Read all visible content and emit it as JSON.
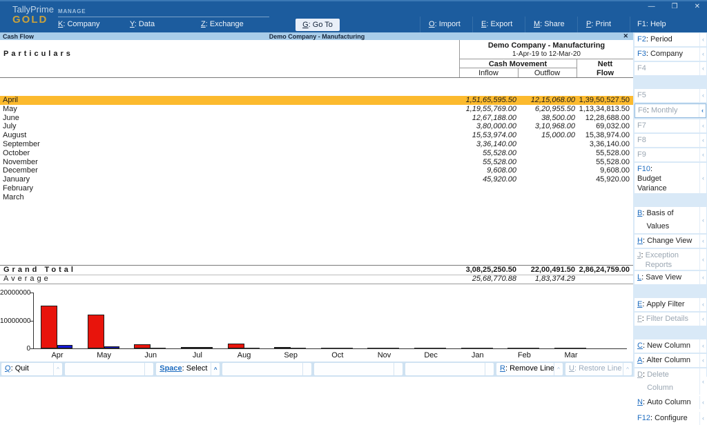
{
  "window": {
    "controls": {
      "minimize": "—",
      "maximize": "❐",
      "close": "✕"
    }
  },
  "brand": {
    "line1": "TallyPrime",
    "line2": "GOLD"
  },
  "topbar": {
    "manage": "MANAGE",
    "sep": ": ",
    "left": [
      {
        "key": "K",
        "label": "Company"
      },
      {
        "key": "Y",
        "label": "Data"
      },
      {
        "key": "Z",
        "label": "Exchange"
      }
    ],
    "goto": {
      "key": "G",
      "label": "Go To"
    },
    "right": [
      {
        "key": "O",
        "label": "Import"
      },
      {
        "key": "E",
        "label": "Export"
      },
      {
        "key": "M",
        "label": "Share"
      },
      {
        "key": "P",
        "label": "Print"
      },
      {
        "key": "F1",
        "label": "Help"
      }
    ]
  },
  "titlebar": {
    "left": "Cash Flow",
    "center": "Demo Company - Manufacturing",
    "close": "✕"
  },
  "report": {
    "particulars_label": "Particulars",
    "company": "Demo Company - Manufacturing",
    "period": "1-Apr-19 to 12-Mar-20",
    "columns": {
      "cash_movement": "Cash Movement",
      "inflow": "Inflow",
      "outflow": "Outflow",
      "nett_l1": "Nett",
      "nett_l2": "Flow"
    },
    "rows": [
      {
        "month": "April",
        "inflow": "1,51,65,595.50",
        "outflow": "12,15,068.00",
        "nett": "1,39,50,527.50",
        "highlighted": true
      },
      {
        "month": "May",
        "inflow": "1,19,55,769.00",
        "outflow": "6,20,955.50",
        "nett": "1,13,34,813.50"
      },
      {
        "month": "June",
        "inflow": "12,67,188.00",
        "outflow": "38,500.00",
        "nett": "12,28,688.00"
      },
      {
        "month": "July",
        "inflow": "3,80,000.00",
        "outflow": "3,10,968.00",
        "nett": "69,032.00"
      },
      {
        "month": "August",
        "inflow": "15,53,974.00",
        "outflow": "15,000.00",
        "nett": "15,38,974.00"
      },
      {
        "month": "September",
        "inflow": "3,36,140.00",
        "outflow": "",
        "nett": "3,36,140.00"
      },
      {
        "month": "October",
        "inflow": "55,528.00",
        "outflow": "",
        "nett": "55,528.00"
      },
      {
        "month": "November",
        "inflow": "55,528.00",
        "outflow": "",
        "nett": "55,528.00"
      },
      {
        "month": "December",
        "inflow": "9,608.00",
        "outflow": "",
        "nett": "9,608.00"
      },
      {
        "month": "January",
        "inflow": "45,920.00",
        "outflow": "",
        "nett": "45,920.00"
      },
      {
        "month": "February",
        "inflow": "",
        "outflow": "",
        "nett": ""
      },
      {
        "month": "March",
        "inflow": "",
        "outflow": "",
        "nett": ""
      }
    ],
    "grand_total": {
      "label": "Grand Total",
      "inflow": "3,08,25,250.50",
      "outflow": "22,00,491.50",
      "nett": "2,86,24,759.00"
    },
    "average": {
      "label": "Average",
      "inflow": "25,68,770.88",
      "outflow": "1,83,374.29",
      "nett": ""
    }
  },
  "chart_data": {
    "type": "bar",
    "title": "",
    "xlabel": "",
    "ylabel": "",
    "categories": [
      "Apr",
      "May",
      "Jun",
      "Jul",
      "Aug",
      "Sep",
      "Oct",
      "Nov",
      "Dec",
      "Jan",
      "Feb",
      "Mar"
    ],
    "series": [
      {
        "name": "Inflow",
        "color": "#e8140c",
        "values": [
          15165595.5,
          11955769,
          1267188,
          380000,
          1553974,
          336140,
          55528,
          55528,
          9608,
          45920,
          0,
          0
        ]
      },
      {
        "name": "Outflow",
        "color": "#1418d8",
        "values": [
          1215068,
          620955.5,
          38500,
          310968,
          15000,
          0,
          0,
          0,
          0,
          0,
          0,
          0
        ]
      }
    ],
    "ylim": [
      0,
      20000000
    ],
    "yticks": [
      20000000,
      10000000,
      0
    ],
    "grid": false,
    "legend": "none"
  },
  "sidebar": {
    "sep": ": ",
    "items": [
      {
        "type": "btn",
        "key": "F2",
        "label": "Period",
        "enabled": true
      },
      {
        "type": "btn",
        "key": "F3",
        "label": "Company",
        "enabled": true
      },
      {
        "type": "btn",
        "key": "F4",
        "label": "",
        "enabled": false,
        "dim": true
      },
      {
        "type": "spacer"
      },
      {
        "type": "btn",
        "key": "F5",
        "label": "",
        "enabled": false,
        "dim": true
      },
      {
        "type": "btn",
        "key": "F6",
        "label": "Monthly",
        "enabled": true,
        "dim": true,
        "boxed": true
      },
      {
        "type": "btn",
        "key": "F7",
        "label": "",
        "enabled": false,
        "dim": true
      },
      {
        "type": "btn",
        "key": "F8",
        "label": "",
        "enabled": false,
        "dim": true
      },
      {
        "type": "btn",
        "key": "F9",
        "label": "",
        "enabled": false,
        "dim": true
      },
      {
        "type": "btn",
        "key": "F10",
        "label": "Budget Variance",
        "enabled": true,
        "two": true
      },
      {
        "type": "spacer"
      },
      {
        "type": "btn",
        "key": "B",
        "label": "Basis of Values",
        "enabled": true
      },
      {
        "type": "btn",
        "key": "H",
        "label": "Change View",
        "enabled": true
      },
      {
        "type": "btn",
        "key": "J",
        "label": "Exception Reports",
        "enabled": false,
        "dim": true,
        "two": true
      },
      {
        "type": "btn",
        "key": "L",
        "label": "Save View",
        "enabled": true
      },
      {
        "type": "spacer"
      },
      {
        "type": "btn",
        "key": "E",
        "label": "Apply Filter",
        "enabled": true
      },
      {
        "type": "btn",
        "key": "F",
        "label": "Filter Details",
        "enabled": false,
        "dim": true
      },
      {
        "type": "spacer"
      },
      {
        "type": "btn",
        "key": "C",
        "label": "New Column",
        "enabled": true
      },
      {
        "type": "btn",
        "key": "A",
        "label": "Alter Column",
        "enabled": true
      },
      {
        "type": "btn",
        "key": "D",
        "label": "Delete Column",
        "enabled": false,
        "dim": true
      },
      {
        "type": "btn",
        "key": "N",
        "label": "Auto Column",
        "enabled": true
      },
      {
        "type": "flex"
      },
      {
        "type": "btn",
        "key": "F12",
        "label": "Configure",
        "enabled": true
      }
    ],
    "arrow": "‹"
  },
  "bottombar": {
    "sep": ": ",
    "caret": "^",
    "items": [
      {
        "key": "Q",
        "label": "Quit",
        "enabled": true,
        "width": 88
      },
      {
        "empty": true
      },
      {
        "key": "Space",
        "label": "Select",
        "enabled": true,
        "accent": true,
        "width": 92
      },
      {
        "empty": true
      },
      {
        "empty": true
      },
      {
        "empty": true
      },
      {
        "key": "R",
        "label": "Remove Line",
        "enabled": true,
        "width": 96
      },
      {
        "key": "U",
        "label": "Restore Line",
        "enabled": false,
        "width": 96
      }
    ]
  },
  "colors": {
    "accent": "#1d6cc0",
    "highlight": "#fcba2e",
    "topbar": "#1c5c9e",
    "titlebar": "#a9cde9"
  }
}
